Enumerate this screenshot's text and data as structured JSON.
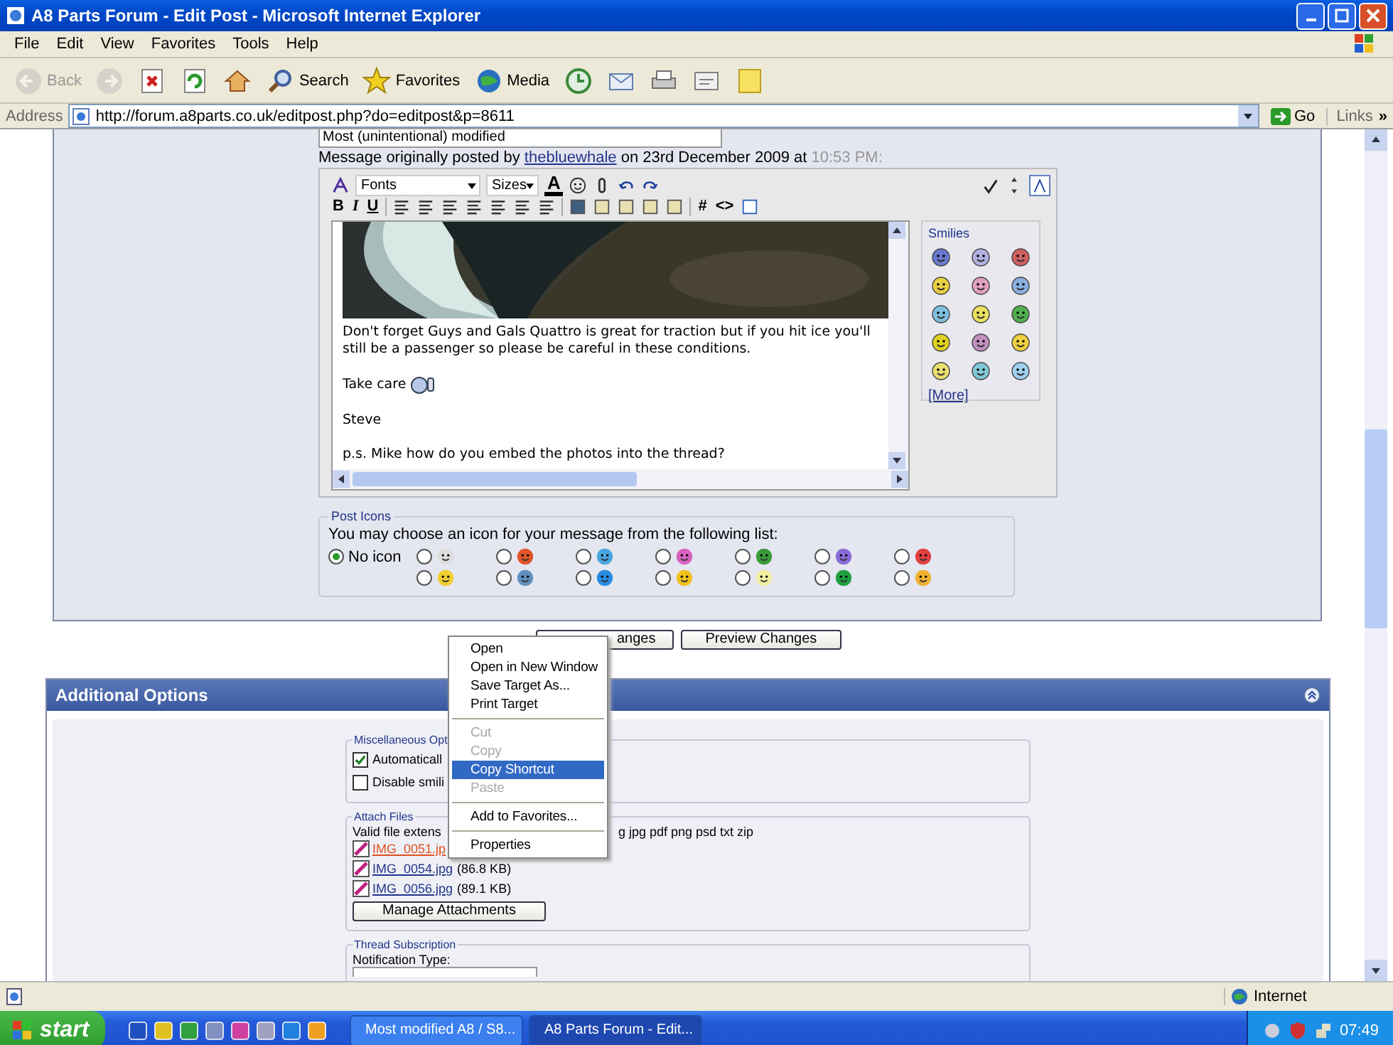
{
  "window": {
    "title": "A8 Parts Forum - Edit Post - Microsoft Internet Explorer"
  },
  "menu": [
    "File",
    "Edit",
    "View",
    "Favorites",
    "Tools",
    "Help"
  ],
  "toolbar": [
    {
      "kind": "back",
      "label": "Back",
      "disabled": true
    },
    {
      "kind": "forward",
      "disabled": true
    },
    {
      "kind": "stop",
      "disabled": false
    },
    {
      "kind": "refresh",
      "disabled": false
    },
    {
      "kind": "home",
      "disabled": false
    },
    {
      "kind": "search",
      "label": "Search",
      "disabled": false
    },
    {
      "kind": "favorites",
      "label": "Favorites",
      "disabled": false
    },
    {
      "kind": "media",
      "label": "Media",
      "disabled": false
    },
    {
      "kind": "history",
      "disabled": false
    },
    {
      "kind": "mail",
      "disabled": false
    },
    {
      "kind": "print",
      "disabled": false
    },
    {
      "kind": "edit",
      "disabled": false
    },
    {
      "kind": "note",
      "disabled": false
    }
  ],
  "address": {
    "label": "Address",
    "url": "http://forum.a8parts.co.uk/editpost.php?do=editpost&p=8611",
    "go": "Go",
    "links": "Links",
    "chevron": "»"
  },
  "post": {
    "title_value": "Most (unintentional) modified",
    "prefix": "Message originally posted by",
    "user": "thebluewhale",
    "middle": "on 23rd December 2009 at",
    "time": "10:53 PM:"
  },
  "editor": {
    "font_select": "Fonts",
    "size_select": "Sizes",
    "text_color": "A",
    "format_buttons": [
      "B",
      "I",
      "U"
    ],
    "code_buttons": [
      "#",
      "<>"
    ],
    "paragraphs": [
      {
        "kind": "text",
        "text": "Don't forget Guys and Gals Quattro is great for traction but if you hit ice you'll still be a passenger so please be careful in these conditions."
      },
      {
        "kind": "smiley",
        "text": "Take care"
      },
      {
        "kind": "text",
        "text": "Steve"
      },
      {
        "kind": "text",
        "text": "p.s. Mike how do you embed the photos into the thread?"
      }
    ],
    "smilies_title": "Smilies",
    "more": "[More]"
  },
  "post_icons": {
    "legend": "Post Icons",
    "prompt": "You may choose an icon for your message from the following list:",
    "options": [
      {
        "label": "No icon",
        "selected": true
      },
      {
        "selected": false
      },
      {
        "selected": false
      },
      {
        "selected": false
      },
      {
        "selected": false
      },
      {
        "selected": false
      },
      {
        "selected": false
      },
      {
        "selected": false
      },
      {
        "selected": false
      },
      {
        "selected": false
      },
      {
        "selected": false
      },
      {
        "selected": false
      },
      {
        "selected": false
      },
      {
        "selected": false
      },
      {
        "selected": false
      }
    ]
  },
  "buttons": [
    "anges",
    "Preview Changes"
  ],
  "context_menu": [
    {
      "kind": "item",
      "label": "Open",
      "disabled": false,
      "selected": false
    },
    {
      "kind": "item",
      "label": "Open in New Window",
      "disabled": false,
      "selected": false
    },
    {
      "kind": "item",
      "label": "Save Target As...",
      "disabled": false,
      "selected": false
    },
    {
      "kind": "item",
      "label": "Print Target",
      "disabled": false,
      "selected": false
    },
    {
      "kind": "separator"
    },
    {
      "kind": "item",
      "label": "Cut",
      "disabled": true,
      "selected": false
    },
    {
      "kind": "item",
      "label": "Copy",
      "disabled": true,
      "selected": false
    },
    {
      "kind": "item",
      "label": "Copy Shortcut",
      "disabled": false,
      "selected": true
    },
    {
      "kind": "item",
      "label": "Paste",
      "disabled": true,
      "selected": false
    },
    {
      "kind": "separator"
    },
    {
      "kind": "item",
      "label": "Add to Favorites...",
      "disabled": false,
      "selected": false
    },
    {
      "kind": "separator"
    },
    {
      "kind": "item",
      "label": "Properties",
      "disabled": false,
      "selected": false
    }
  ],
  "additional": {
    "title": "Additional Options",
    "misc": {
      "legend": "Miscellaneous Opt",
      "options": [
        {
          "label": "Automaticall",
          "checked": true
        },
        {
          "label": "Disable smili",
          "checked": false
        }
      ]
    },
    "attach": {
      "legend": "Attach Files",
      "ext_left": "Valid file extens",
      "ext_right": "g jpg pdf png psd txt zip",
      "files": [
        {
          "name": "IMG_0051.jp",
          "hover": true
        },
        {
          "name": "IMG_0054.jpg",
          "size": "(86.8 KB)",
          "hover": false
        },
        {
          "name": "IMG_0056.jpg",
          "size": "(89.1 KB)",
          "hover": false
        }
      ],
      "manage": "Manage Attachments"
    },
    "subscription": {
      "legend": "Thread Subscription",
      "label": "Notification Type:"
    }
  },
  "status_bar": {
    "zone": "Internet"
  },
  "taskbar": {
    "start": "start",
    "tasks": [
      {
        "label": "Most modified A8 / S8...",
        "selected": false
      },
      {
        "label": "A8 Parts Forum - Edit...",
        "selected": true
      }
    ],
    "clock": "07:49"
  }
}
